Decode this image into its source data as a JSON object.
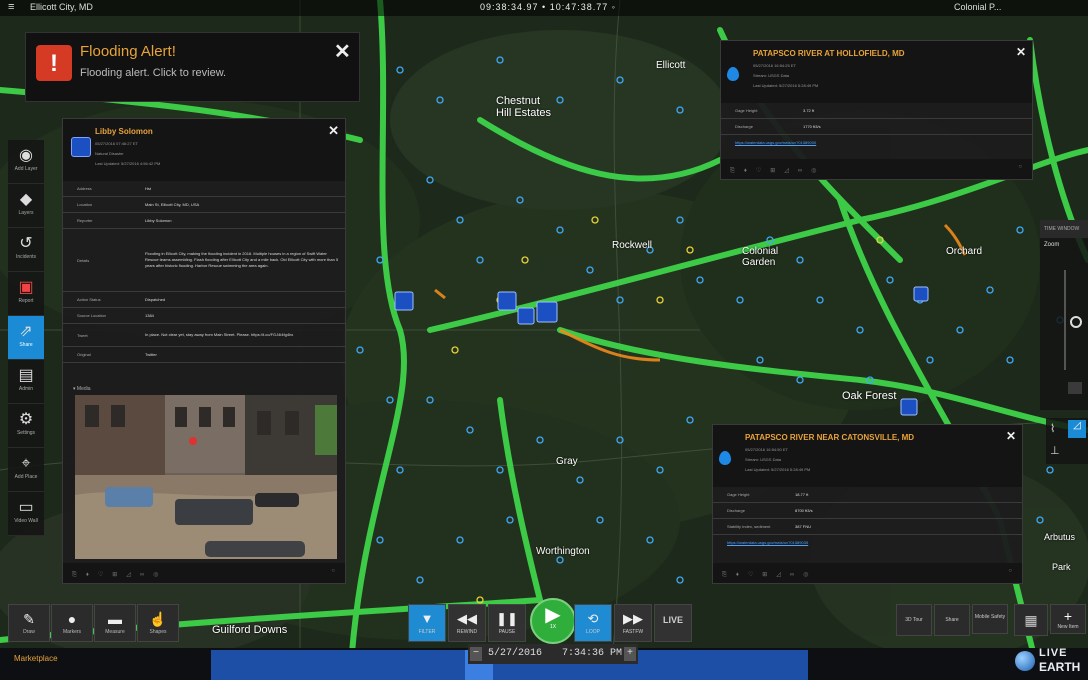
{
  "topbar": {
    "location": "Ellicott City, MD",
    "clock": "09:38:34.97 • 10:47:38.77 ◦",
    "right_label": "Colonial P..."
  },
  "map": {
    "place_labels": [
      "Chestnut Hill Estates",
      "Rockwell",
      "Colonial Garden",
      "Oak Forest",
      "Gray",
      "Worthington",
      "Guilford Downs",
      "Orchard",
      "Ellicott",
      "Park",
      "Arbutus"
    ]
  },
  "alert": {
    "title": "Flooding Alert!",
    "subtitle": "Flooding alert. Click to review.",
    "icon": "warning-triangle-icon"
  },
  "toolbar_left": {
    "items": [
      {
        "label": "Add Layer",
        "icon": "eye-icon"
      },
      {
        "label": "Layers",
        "icon": "arrow-left-icon"
      },
      {
        "label": "Incidents",
        "icon": "incident-icon"
      },
      {
        "label": "Report",
        "icon": "map-pin-icon"
      },
      {
        "label": "Share",
        "icon": "share-icon"
      },
      {
        "label": "Admin",
        "icon": "building-icon"
      },
      {
        "label": "Settings",
        "icon": "gear-icon"
      },
      {
        "label": "Add Place",
        "icon": "location-add-icon"
      },
      {
        "label": "Video Wall",
        "icon": "monitor-icon"
      }
    ]
  },
  "incident_panel": {
    "title": "Libby Solomon",
    "lines": [
      "05/27/2016 07:46:27 ET",
      "Natural Disaster",
      "Last Updated: 5/27/2016 4:56:42 PM"
    ],
    "fields": [
      {
        "key": "Address",
        "value": "Hst"
      },
      {
        "key": "Location",
        "value": "Main St, Ellicott City, MD, USA"
      },
      {
        "key": "Reporter",
        "value": "Libby Solomon"
      },
      {
        "key": "Details",
        "value": "Flooding in Ellicott City, making the flooding incident in 2016. Multiple houses in a region of Swift Water Rescue teams assembling. Flash flooding after Ellicott City and a mile back. Old Ellicott City with more than 5 years after historic flooding. Harbor Rescue swimming the area again."
      },
      {
        "key": "Action Status",
        "value": "Dispatched"
      },
      {
        "key": "Source Location",
        "value": "1384"
      },
      {
        "key": "Tweet",
        "value": "In place. Not clear yet, stay away from Main Street. Please. https://t.co/FGJ4i4fg4hx"
      },
      {
        "key": "Original",
        "value": "Twitter"
      }
    ],
    "media_label": "Media"
  },
  "gauge_panel_1": {
    "title": "PATAPSCO RIVER AT HOLLOFIELD, MD",
    "lines": [
      "05/27/2016 16:54:25 ET",
      "Stream: USGS Data",
      "Last Updated: 5/27/2016 5:28:49 PM"
    ],
    "fields": [
      {
        "key": "Gage Height",
        "value": "3.72 ft"
      },
      {
        "key": "Discharge",
        "value": "1770 ft3/s"
      }
    ],
    "link": "https://waterdata.usgs.gov/nwis/uv?01589000"
  },
  "gauge_panel_2": {
    "title": "PATAPSCO RIVER NEAR CATONSVILLE, MD",
    "lines": [
      "05/27/2016 16:54:50 ET",
      "Stream: USGS Data",
      "Last Updated: 5/27/2016 5:28:49 PM"
    ],
    "fields": [
      {
        "key": "Gage Height",
        "value": "18.77 ft"
      },
      {
        "key": "Discharge",
        "value": "8700 ft3/s"
      },
      {
        "key": "Stability Index, sediment",
        "value": "387 FNU"
      }
    ],
    "link": "https://waterdata.usgs.gov/nwis/uv?01589035"
  },
  "right_widget": {
    "title": "TIME WINDOW",
    "label": "Zoom"
  },
  "bottom_tools": [
    {
      "label": "Draw",
      "icon": "pencil-icon"
    },
    {
      "label": "Markers",
      "icon": "marker-icon"
    },
    {
      "label": "Measure",
      "icon": "ruler-icon"
    },
    {
      "label": "Shapes",
      "icon": "pointer-icon"
    }
  ],
  "playback": {
    "filter": "FILTER",
    "rewind": "REWIND",
    "pause": "PAUSE",
    "play": "1X",
    "loop": "LOOP",
    "forward": "FASTFW",
    "live": "LIVE"
  },
  "right_buttons": {
    "b1": "3D Tour",
    "b2": "Share",
    "b3": "Mobile Safety",
    "b4": "Apps",
    "b5": "New Item"
  },
  "status": {
    "marketplace": "Marketplace",
    "date": "5/27/2016",
    "time": "7:34:36 PM"
  },
  "brand": {
    "logo_line1": "LIVE",
    "logo_line2": "EARTH"
  },
  "colors": {
    "accent_orange": "#e8a33a",
    "road_green": "#3ed34a",
    "active_blue": "#1a8bd4",
    "play_green": "#2fae3c",
    "alert_red": "#d53a24"
  }
}
